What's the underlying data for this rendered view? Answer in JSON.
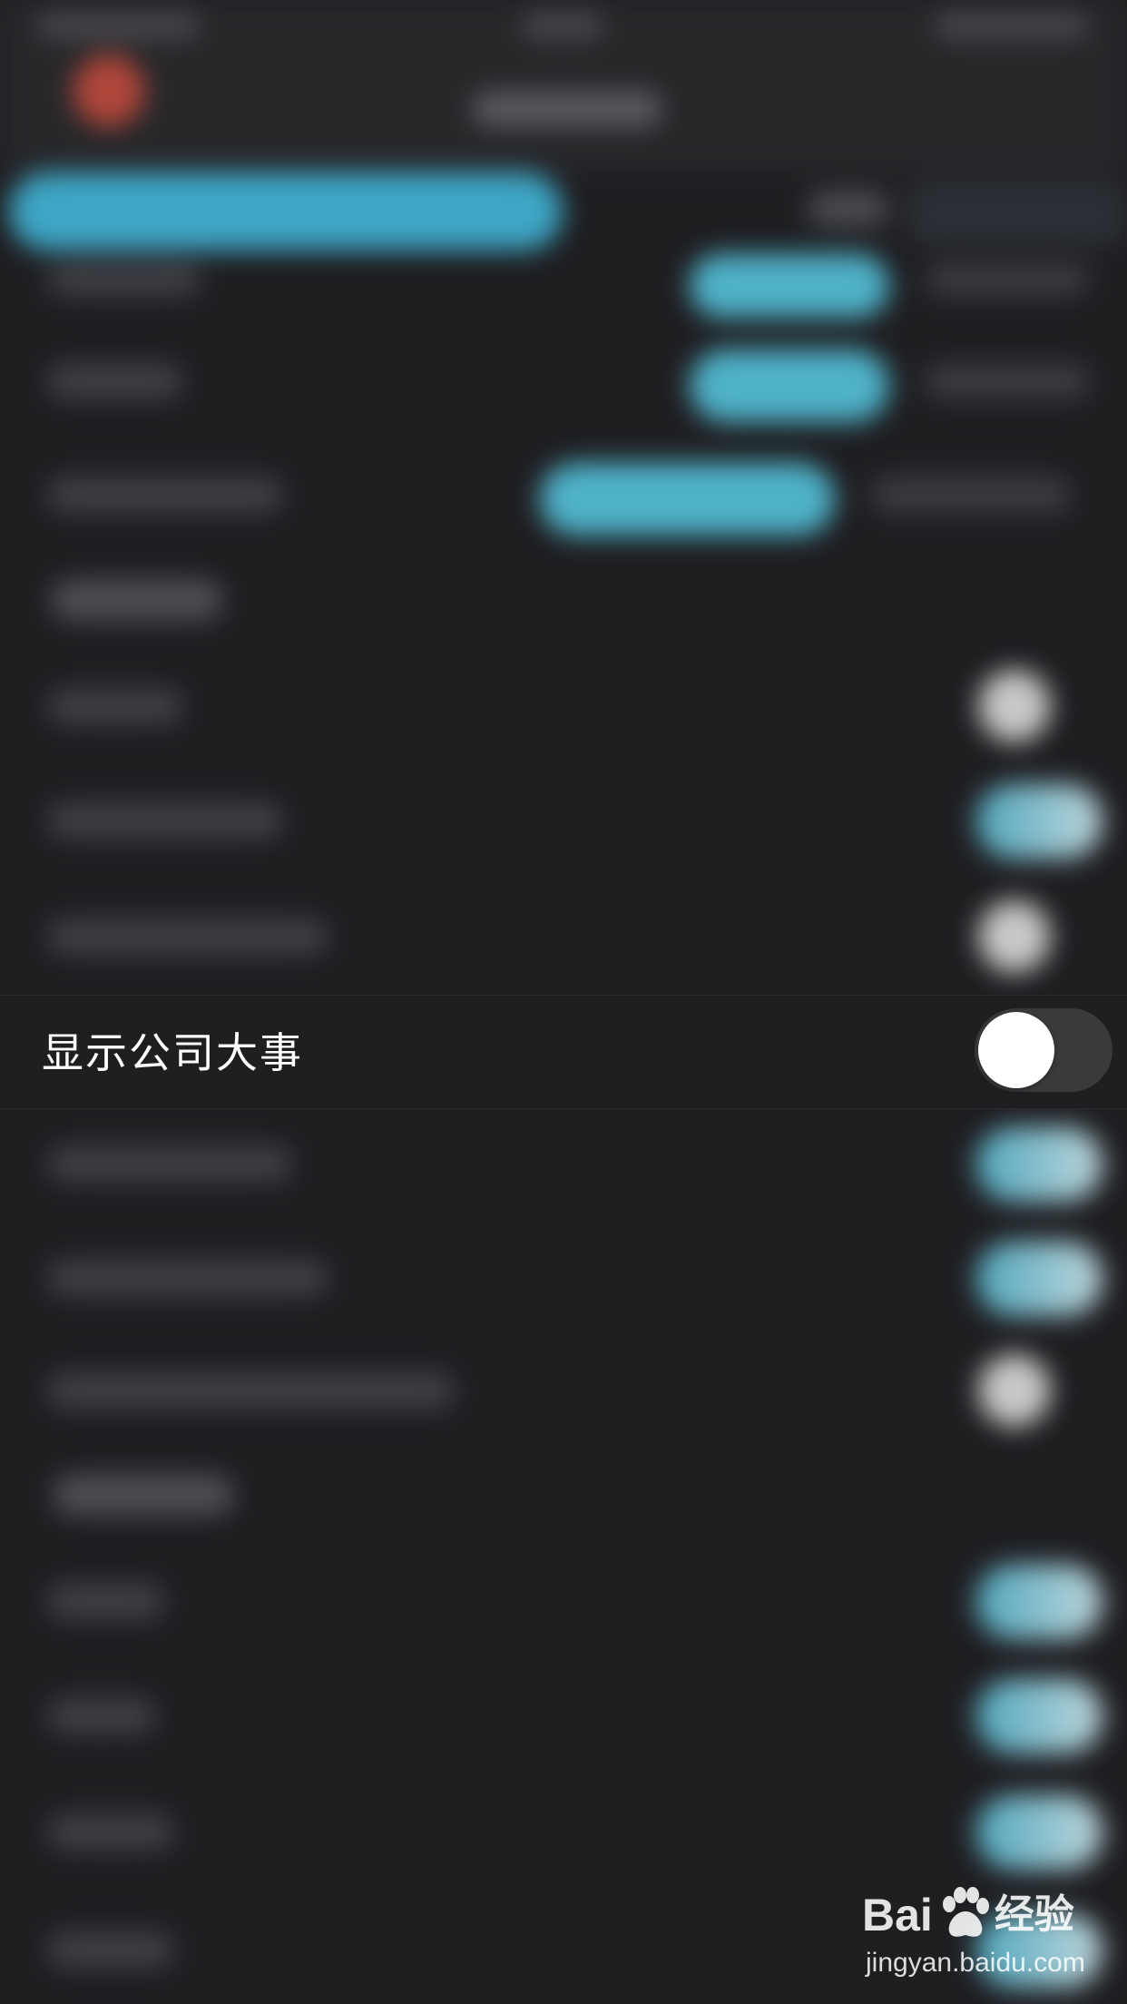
{
  "setting_row": {
    "label": "显示公司大事",
    "toggle_state": "off"
  },
  "watermark": {
    "brand_prefix": "Bai",
    "brand_suffix": "经验",
    "url": "jingyan.baidu.com"
  },
  "colors": {
    "background": "#1f1f22",
    "accent": "#3ea6c5",
    "toggle_track_off": "#3a3a3d",
    "toggle_knob": "#ffffff",
    "back_icon": "#b0463a"
  }
}
